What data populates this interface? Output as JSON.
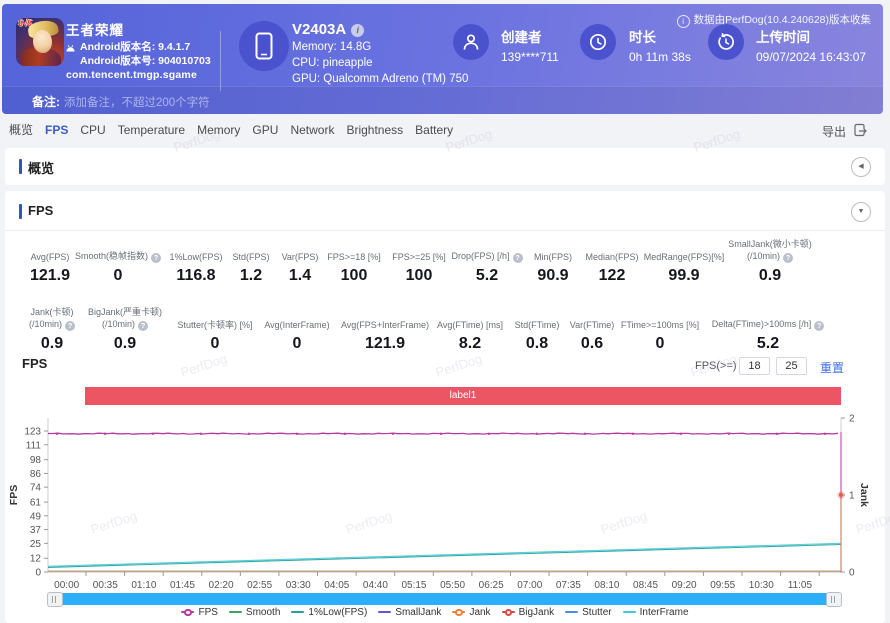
{
  "header": {
    "game": {
      "name": "王者荣耀",
      "badge": "5√5",
      "version_name": "Android版本名: 9.4.1.7",
      "version_code": "Android版本号: 904010703",
      "package": "com.tencent.tmgp.sgame"
    },
    "device": {
      "model": "V2403A",
      "memory": "Memory: 14.8G",
      "cpu": "CPU: pineapple",
      "gpu": "GPU: Qualcomm Adreno (TM) 750"
    },
    "creator": {
      "label": "创建者",
      "value": "139****711"
    },
    "duration": {
      "label": "时长",
      "value": "0h 11m 38s"
    },
    "upload": {
      "label": "上传时间",
      "value": "09/07/2024 16:43:07"
    },
    "collect_info": "数据由PerfDog(10.4.240628)版本收集",
    "note": {
      "label": "备注:",
      "placeholder": "添加备注，不超过200个字符"
    }
  },
  "tabs": {
    "items": [
      "概览",
      "FPS",
      "CPU",
      "Temperature",
      "Memory",
      "GPU",
      "Network",
      "Brightness",
      "Battery"
    ],
    "active": "FPS",
    "export_label": "导出"
  },
  "sections": {
    "overview_title": "概览",
    "fps_title": "FPS"
  },
  "stats": {
    "row1": [
      {
        "label": [
          "Avg(FPS)"
        ],
        "value": "121.9"
      },
      {
        "label": [
          "Smooth(稳帧指数)"
        ],
        "help": true,
        "value": "0"
      },
      {
        "label": [
          "1%Low(FPS)"
        ],
        "value": "116.8"
      },
      {
        "label": [
          "Std(FPS)"
        ],
        "value": "1.2"
      },
      {
        "label": [
          "Var(FPS)"
        ],
        "value": "1.4"
      },
      {
        "label": [
          "FPS>=18 [%]"
        ],
        "value": "100"
      },
      {
        "label": [
          "FPS>=25 [%]"
        ],
        "value": "100"
      },
      {
        "label": [
          "Drop(FPS) [/h]"
        ],
        "help": true,
        "value": "5.2"
      },
      {
        "label": [
          "Min(FPS)"
        ],
        "value": "90.9"
      },
      {
        "label": [
          "Median(FPS)"
        ],
        "value": "122"
      },
      {
        "label": [
          "MedRange(FPS)[%]"
        ],
        "value": "99.9"
      },
      {
        "label": [
          "SmallJank(微小卡顿)",
          "(/10min)"
        ],
        "help": true,
        "value": "0.9"
      }
    ],
    "row2": [
      {
        "label": [
          "Jank(卡顿)",
          "(/10min)"
        ],
        "help": true,
        "value": "0.9"
      },
      {
        "label": [
          "BigJank(严重卡顿)",
          "(/10min)"
        ],
        "help": true,
        "value": "0.9"
      },
      {
        "label": [
          "Stutter(卡顿率) [%]"
        ],
        "value": "0"
      },
      {
        "label": [
          "Avg(InterFrame)"
        ],
        "value": "0"
      },
      {
        "label": [
          "Avg(FPS+InterFrame)"
        ],
        "value": "121.9"
      },
      {
        "label": [
          "Avg(FTime) [ms]"
        ],
        "value": "8.2"
      },
      {
        "label": [
          "Std(FTime)"
        ],
        "value": "0.8"
      },
      {
        "label": [
          "Var(FTime)"
        ],
        "value": "0.6"
      },
      {
        "label": [
          "FTime>=100ms [%]"
        ],
        "value": "0"
      },
      {
        "label": [
          "Delta(FTime)>100ms [/h]"
        ],
        "help": true,
        "value": "5.2"
      }
    ]
  },
  "fps_chart": {
    "subtitle": "FPS",
    "threshold_label": "FPS(>=)",
    "threshold1": "18",
    "threshold2": "25",
    "reset_label": "重置",
    "band_label": "label1",
    "chart_data": {
      "type": "line",
      "ylabel_left": "FPS",
      "ylabel_right": "Jank",
      "y_left_ticks": [
        0,
        12,
        25,
        37,
        49,
        61,
        74,
        86,
        98,
        111,
        123
      ],
      "y_left_max": 123,
      "y_right_ticks": [
        0,
        1,
        2
      ],
      "y_right_max": 2,
      "x_ticks": [
        "00:00",
        "00:35",
        "01:10",
        "01:45",
        "02:20",
        "02:55",
        "03:30",
        "04:05",
        "04:40",
        "05:15",
        "05:50",
        "06:25",
        "07:00",
        "07:35",
        "08:10",
        "08:45",
        "09:20",
        "09:55",
        "10:30",
        "11:05"
      ],
      "series": [
        {
          "name": "FPS",
          "color": "#b8399f",
          "axis": "left",
          "shape": "flat",
          "level": 122,
          "end_drop": true
        },
        {
          "name": "Smooth",
          "color": "#3ca559",
          "axis": "left",
          "shape": "zero"
        },
        {
          "name": "1%Low(FPS)",
          "color": "#21a296",
          "axis": "left",
          "shape": "ramp",
          "start": 4,
          "end": 24
        },
        {
          "name": "SmallJank",
          "color": "#5b59d8",
          "axis": "right",
          "shape": "zero"
        },
        {
          "name": "Jank",
          "color": "#ef7f3c",
          "axis": "right",
          "shape": "zero",
          "end_spike": 1
        },
        {
          "name": "BigJank",
          "color": "#d94a45",
          "axis": "right",
          "shape": "zero"
        },
        {
          "name": "Stutter",
          "color": "#4a8ede",
          "axis": "left",
          "shape": "zero"
        },
        {
          "name": "InterFrame",
          "color": "#45c8dc",
          "axis": "left",
          "shape": "ramp",
          "start": 5,
          "end": 25
        }
      ]
    }
  },
  "watermark": "PerfDog",
  "icons": {
    "info": "i",
    "help": "?",
    "collapse_left": "◀",
    "collapse_down": "▼"
  }
}
